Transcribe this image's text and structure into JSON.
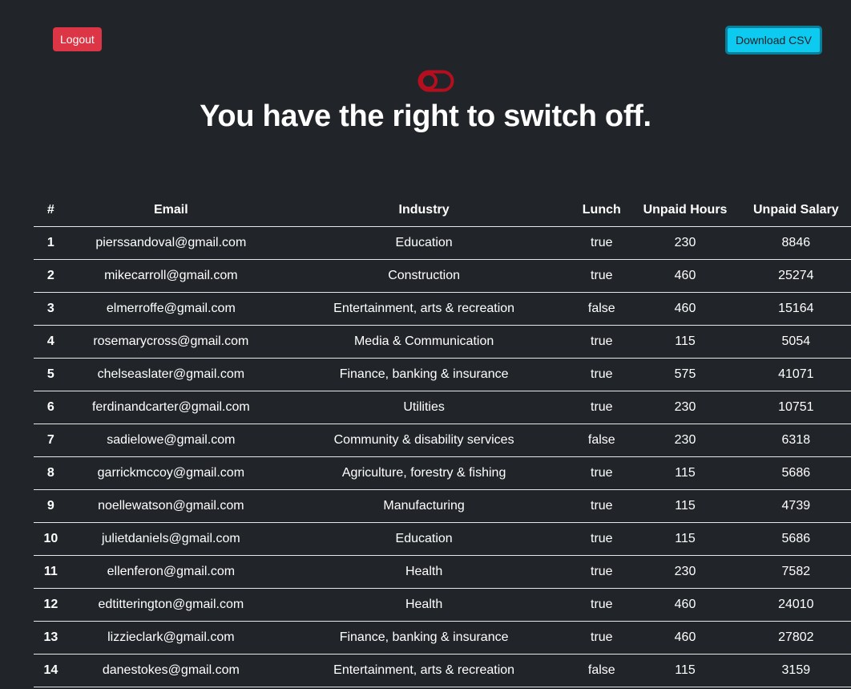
{
  "header": {
    "logout_label": "Logout",
    "download_label": "Download CSV",
    "logo_icon": "toggle-switch-icon",
    "logo_color": "#b30f1e",
    "headline": "You have the right to switch off."
  },
  "colors": {
    "background": "#212529",
    "logout_button": "#dc3545",
    "download_button": "#0dcaf0"
  },
  "table": {
    "columns": [
      "#",
      "Email",
      "Industry",
      "Lunch",
      "Unpaid Hours",
      "Unpaid Salary"
    ],
    "rows": [
      [
        "1",
        "pierssandoval@gmail.com",
        "Education",
        "true",
        "230",
        "8846"
      ],
      [
        "2",
        "mikecarroll@gmail.com",
        "Construction",
        "true",
        "460",
        "25274"
      ],
      [
        "3",
        "elmerroffe@gmail.com",
        "Entertainment, arts & recreation",
        "false",
        "460",
        "15164"
      ],
      [
        "4",
        "rosemarycross@gmail.com",
        "Media & Communication",
        "true",
        "115",
        "5054"
      ],
      [
        "5",
        "chelseaslater@gmail.com",
        "Finance, banking & insurance",
        "true",
        "575",
        "41071"
      ],
      [
        "6",
        "ferdinandcarter@gmail.com",
        "Utilities",
        "true",
        "230",
        "10751"
      ],
      [
        "7",
        "sadielowe@gmail.com",
        "Community & disability services",
        "false",
        "230",
        "6318"
      ],
      [
        "8",
        "garrickmccoy@gmail.com",
        "Agriculture, forestry & fishing",
        "true",
        "115",
        "5686"
      ],
      [
        "9",
        "noellewatson@gmail.com",
        "Manufacturing",
        "true",
        "115",
        "4739"
      ],
      [
        "10",
        "julietdaniels@gmail.com",
        "Education",
        "true",
        "115",
        "5686"
      ],
      [
        "11",
        "ellenferon@gmail.com",
        "Health",
        "true",
        "230",
        "7582"
      ],
      [
        "12",
        "edtitterington@gmail.com",
        "Health",
        "true",
        "460",
        "24010"
      ],
      [
        "13",
        "lizzieclark@gmail.com",
        "Finance, banking & insurance",
        "true",
        "460",
        "27802"
      ],
      [
        "14",
        "danestokes@gmail.com",
        "Entertainment, arts & recreation",
        "false",
        "115",
        "3159"
      ]
    ]
  }
}
